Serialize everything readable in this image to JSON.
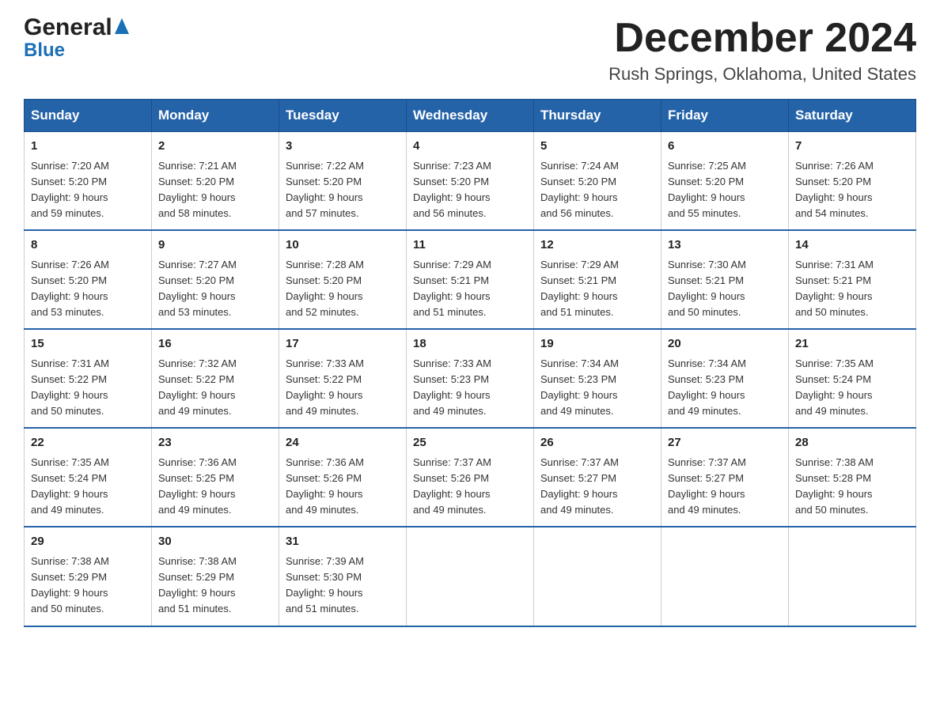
{
  "logo": {
    "line1": "General",
    "line2": "Blue"
  },
  "header": {
    "month_title": "December 2024",
    "location": "Rush Springs, Oklahoma, United States"
  },
  "weekdays": [
    "Sunday",
    "Monday",
    "Tuesday",
    "Wednesday",
    "Thursday",
    "Friday",
    "Saturday"
  ],
  "weeks": [
    [
      {
        "day": "1",
        "sunrise": "7:20 AM",
        "sunset": "5:20 PM",
        "daylight": "9 hours and 59 minutes."
      },
      {
        "day": "2",
        "sunrise": "7:21 AM",
        "sunset": "5:20 PM",
        "daylight": "9 hours and 58 minutes."
      },
      {
        "day": "3",
        "sunrise": "7:22 AM",
        "sunset": "5:20 PM",
        "daylight": "9 hours and 57 minutes."
      },
      {
        "day": "4",
        "sunrise": "7:23 AM",
        "sunset": "5:20 PM",
        "daylight": "9 hours and 56 minutes."
      },
      {
        "day": "5",
        "sunrise": "7:24 AM",
        "sunset": "5:20 PM",
        "daylight": "9 hours and 56 minutes."
      },
      {
        "day": "6",
        "sunrise": "7:25 AM",
        "sunset": "5:20 PM",
        "daylight": "9 hours and 55 minutes."
      },
      {
        "day": "7",
        "sunrise": "7:26 AM",
        "sunset": "5:20 PM",
        "daylight": "9 hours and 54 minutes."
      }
    ],
    [
      {
        "day": "8",
        "sunrise": "7:26 AM",
        "sunset": "5:20 PM",
        "daylight": "9 hours and 53 minutes."
      },
      {
        "day": "9",
        "sunrise": "7:27 AM",
        "sunset": "5:20 PM",
        "daylight": "9 hours and 53 minutes."
      },
      {
        "day": "10",
        "sunrise": "7:28 AM",
        "sunset": "5:20 PM",
        "daylight": "9 hours and 52 minutes."
      },
      {
        "day": "11",
        "sunrise": "7:29 AM",
        "sunset": "5:21 PM",
        "daylight": "9 hours and 51 minutes."
      },
      {
        "day": "12",
        "sunrise": "7:29 AM",
        "sunset": "5:21 PM",
        "daylight": "9 hours and 51 minutes."
      },
      {
        "day": "13",
        "sunrise": "7:30 AM",
        "sunset": "5:21 PM",
        "daylight": "9 hours and 50 minutes."
      },
      {
        "day": "14",
        "sunrise": "7:31 AM",
        "sunset": "5:21 PM",
        "daylight": "9 hours and 50 minutes."
      }
    ],
    [
      {
        "day": "15",
        "sunrise": "7:31 AM",
        "sunset": "5:22 PM",
        "daylight": "9 hours and 50 minutes."
      },
      {
        "day": "16",
        "sunrise": "7:32 AM",
        "sunset": "5:22 PM",
        "daylight": "9 hours and 49 minutes."
      },
      {
        "day": "17",
        "sunrise": "7:33 AM",
        "sunset": "5:22 PM",
        "daylight": "9 hours and 49 minutes."
      },
      {
        "day": "18",
        "sunrise": "7:33 AM",
        "sunset": "5:23 PM",
        "daylight": "9 hours and 49 minutes."
      },
      {
        "day": "19",
        "sunrise": "7:34 AM",
        "sunset": "5:23 PM",
        "daylight": "9 hours and 49 minutes."
      },
      {
        "day": "20",
        "sunrise": "7:34 AM",
        "sunset": "5:23 PM",
        "daylight": "9 hours and 49 minutes."
      },
      {
        "day": "21",
        "sunrise": "7:35 AM",
        "sunset": "5:24 PM",
        "daylight": "9 hours and 49 minutes."
      }
    ],
    [
      {
        "day": "22",
        "sunrise": "7:35 AM",
        "sunset": "5:24 PM",
        "daylight": "9 hours and 49 minutes."
      },
      {
        "day": "23",
        "sunrise": "7:36 AM",
        "sunset": "5:25 PM",
        "daylight": "9 hours and 49 minutes."
      },
      {
        "day": "24",
        "sunrise": "7:36 AM",
        "sunset": "5:26 PM",
        "daylight": "9 hours and 49 minutes."
      },
      {
        "day": "25",
        "sunrise": "7:37 AM",
        "sunset": "5:26 PM",
        "daylight": "9 hours and 49 minutes."
      },
      {
        "day": "26",
        "sunrise": "7:37 AM",
        "sunset": "5:27 PM",
        "daylight": "9 hours and 49 minutes."
      },
      {
        "day": "27",
        "sunrise": "7:37 AM",
        "sunset": "5:27 PM",
        "daylight": "9 hours and 49 minutes."
      },
      {
        "day": "28",
        "sunrise": "7:38 AM",
        "sunset": "5:28 PM",
        "daylight": "9 hours and 50 minutes."
      }
    ],
    [
      {
        "day": "29",
        "sunrise": "7:38 AM",
        "sunset": "5:29 PM",
        "daylight": "9 hours and 50 minutes."
      },
      {
        "day": "30",
        "sunrise": "7:38 AM",
        "sunset": "5:29 PM",
        "daylight": "9 hours and 51 minutes."
      },
      {
        "day": "31",
        "sunrise": "7:39 AM",
        "sunset": "5:30 PM",
        "daylight": "9 hours and 51 minutes."
      },
      null,
      null,
      null,
      null
    ]
  ],
  "labels": {
    "sunrise": "Sunrise:",
    "sunset": "Sunset:",
    "daylight": "Daylight:"
  }
}
